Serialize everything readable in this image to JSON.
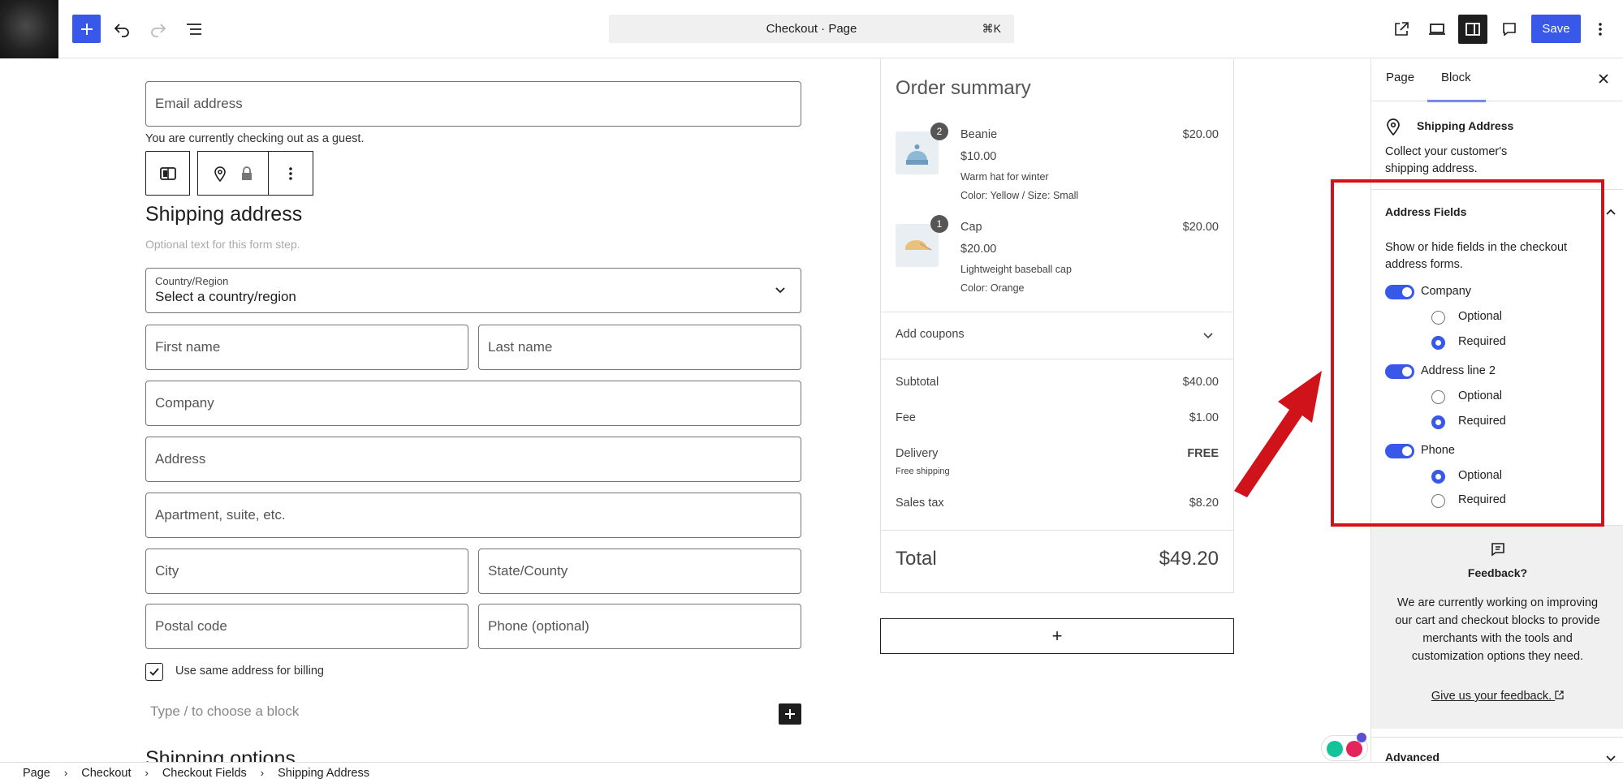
{
  "topbar": {
    "command_title": "Checkout · Page",
    "command_shortcut": "⌘K",
    "save_label": "Save"
  },
  "form": {
    "email_placeholder": "Email address",
    "guest_note": "You are currently checking out as a guest.",
    "shipping_heading": "Shipping address",
    "shipping_optional_text": "Optional text for this form step.",
    "country_label": "Country/Region",
    "country_value": "Select a country/region",
    "first_name": "First name",
    "last_name": "Last name",
    "company": "Company",
    "address": "Address",
    "apartment": "Apartment, suite, etc.",
    "city": "City",
    "state": "State/County",
    "postal": "Postal code",
    "phone": "Phone (optional)",
    "billing_label": "Use same address for billing",
    "block_placeholder": "Type / to choose a block",
    "shipping_options_heading": "Shipping options"
  },
  "summary": {
    "title": "Order summary",
    "items": [
      {
        "qty": "2",
        "name": "Beanie",
        "price": "$10.00",
        "total": "$20.00",
        "desc": "Warm hat for winter",
        "meta": "Color: Yellow / Size: Small"
      },
      {
        "qty": "1",
        "name": "Cap",
        "price": "$20.00",
        "total": "$20.00",
        "desc": "Lightweight baseball cap",
        "meta": "Color: Orange"
      }
    ],
    "coupons_label": "Add coupons",
    "subtotal_label": "Subtotal",
    "subtotal_value": "$40.00",
    "fee_label": "Fee",
    "fee_value": "$1.00",
    "delivery_label": "Delivery",
    "delivery_value": "FREE",
    "delivery_note": "Free shipping",
    "tax_label": "Sales tax",
    "tax_value": "$8.20",
    "total_label": "Total",
    "total_value": "$49.20",
    "add_block_symbol": "+"
  },
  "sidebar": {
    "tab_page": "Page",
    "tab_block": "Block",
    "block_name": "Shipping Address",
    "block_desc": "Collect your customer's shipping address.",
    "section_title": "Address Fields",
    "section_desc": "Show or hide fields in the checkout address forms.",
    "fields": [
      {
        "label": "Company",
        "enabled": true,
        "optional_label": "Optional",
        "required_label": "Required",
        "selected": "required"
      },
      {
        "label": "Address line 2",
        "enabled": true,
        "optional_label": "Optional",
        "required_label": "Required",
        "selected": "required"
      },
      {
        "label": "Phone",
        "enabled": true,
        "optional_label": "Optional",
        "required_label": "Required",
        "selected": "optional"
      }
    ],
    "feedback_title": "Feedback?",
    "feedback_text": "We are currently working on improving our cart and checkout blocks to provide merchants with the tools and customization options they need.",
    "feedback_link": "Give us your feedback.",
    "advanced_label": "Advanced"
  },
  "breadcrumb": [
    "Page",
    "Checkout",
    "Checkout Fields",
    "Shipping Address"
  ],
  "colors": {
    "accent": "#3858e9",
    "annotation": "#d0121a"
  }
}
